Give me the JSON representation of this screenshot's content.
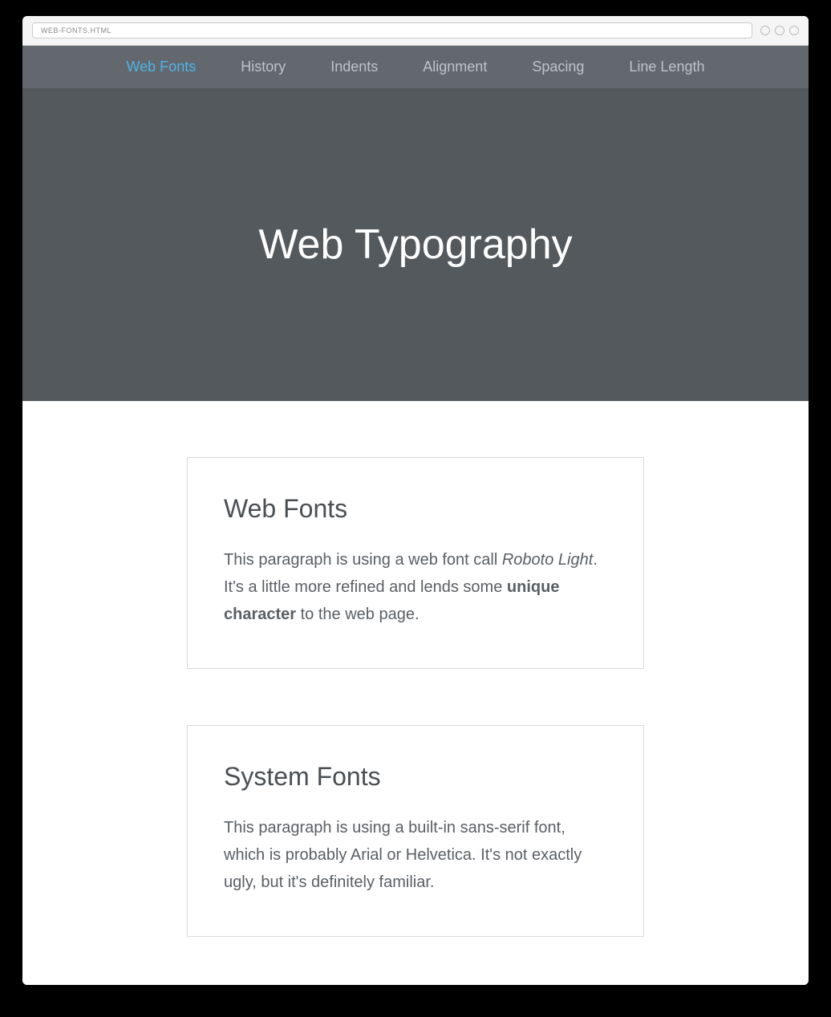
{
  "browser": {
    "url": "WEB-FONTS.HTML"
  },
  "nav": {
    "items": [
      {
        "label": "Web Fonts",
        "active": true
      },
      {
        "label": "History",
        "active": false
      },
      {
        "label": "Indents",
        "active": false
      },
      {
        "label": "Alignment",
        "active": false
      },
      {
        "label": "Spacing",
        "active": false
      },
      {
        "label": "Line Length",
        "active": false
      }
    ]
  },
  "hero": {
    "title": "Web Typography"
  },
  "cards": {
    "webfonts": {
      "title": "Web Fonts",
      "text_pre": "This paragraph is using a web font call ",
      "text_em": "Roboto Light",
      "text_mid": ". It's a little more refined and lends some ",
      "text_strong": "unique character",
      "text_post": " to the web page."
    },
    "systemfonts": {
      "title": "System Fonts",
      "text": "This paragraph is using a built-in sans-serif font, which is probably Arial or Helvetica. It's not exactly ugly, but it's definitely familiar."
    }
  }
}
